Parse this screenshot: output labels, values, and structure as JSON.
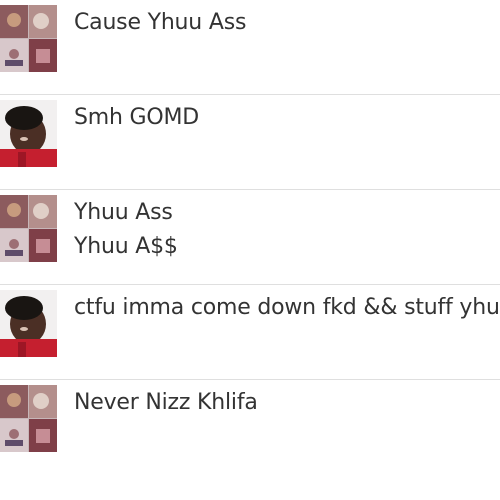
{
  "messages": [
    {
      "avatar": "collage-avatar",
      "lines": [
        "Cause Yhuu Ass"
      ]
    },
    {
      "avatar": "boy-avatar",
      "lines": [
        "Smh GOMD"
      ]
    },
    {
      "avatar": "collage-avatar",
      "lines": [
        "Yhuu Ass",
        "Yhuu A$$"
      ]
    },
    {
      "avatar": "boy-avatar",
      "lines": [
        "ctfu imma come down fkd && stuff yhu"
      ]
    },
    {
      "avatar": "collage-avatar",
      "lines": [
        "Never Nizz Khlifa"
      ]
    }
  ],
  "colors": {
    "text": "#333333",
    "divider": "#dfdfdf",
    "background": "#ffffff"
  }
}
